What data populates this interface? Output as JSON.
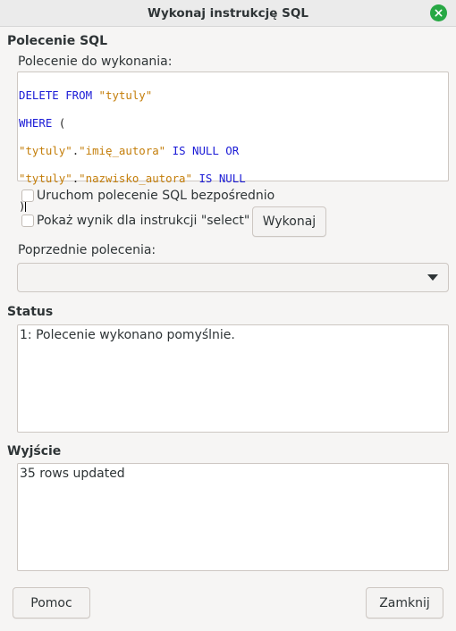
{
  "window": {
    "title": "Wykonaj instrukcję SQL"
  },
  "sql_section": {
    "heading": "Polecenie SQL",
    "command_label": "Polecenie do wykonania:",
    "code": {
      "line1_kw": "DELETE FROM",
      "line1_str": "\"tytuly\"",
      "line2_kw": "WHERE",
      "line2_plain": "(",
      "line3_str_a": "\"tytuly\"",
      "line3_dot": ".",
      "line3_str_b": "\"imię_autora\"",
      "line3_kw": "IS NULL OR",
      "line4_str_a": "\"tytuly\"",
      "line4_dot": ".",
      "line4_str_b": "\"nazwisko_autora\"",
      "line4_kw": "IS NULL",
      "line5_plain": ")"
    },
    "run_directly_label": "Uruchom polecenie SQL bezpośrednio",
    "show_result_label": "Pokaż wynik dla instrukcji \"select\"",
    "execute_button": "Wykonaj",
    "previous_label": "Poprzednie polecenia:",
    "previous_selected": ""
  },
  "status_section": {
    "heading": "Status",
    "text": "1: Polecenie wykonano pomyślnie."
  },
  "output_section": {
    "heading": "Wyjście",
    "text": "35 rows updated"
  },
  "footer": {
    "help_button": "Pomoc",
    "close_button": "Zamknij"
  },
  "colors": {
    "keyword": "#1a1ad6",
    "string": "#c47e0a",
    "close_circle": "#27a844"
  }
}
